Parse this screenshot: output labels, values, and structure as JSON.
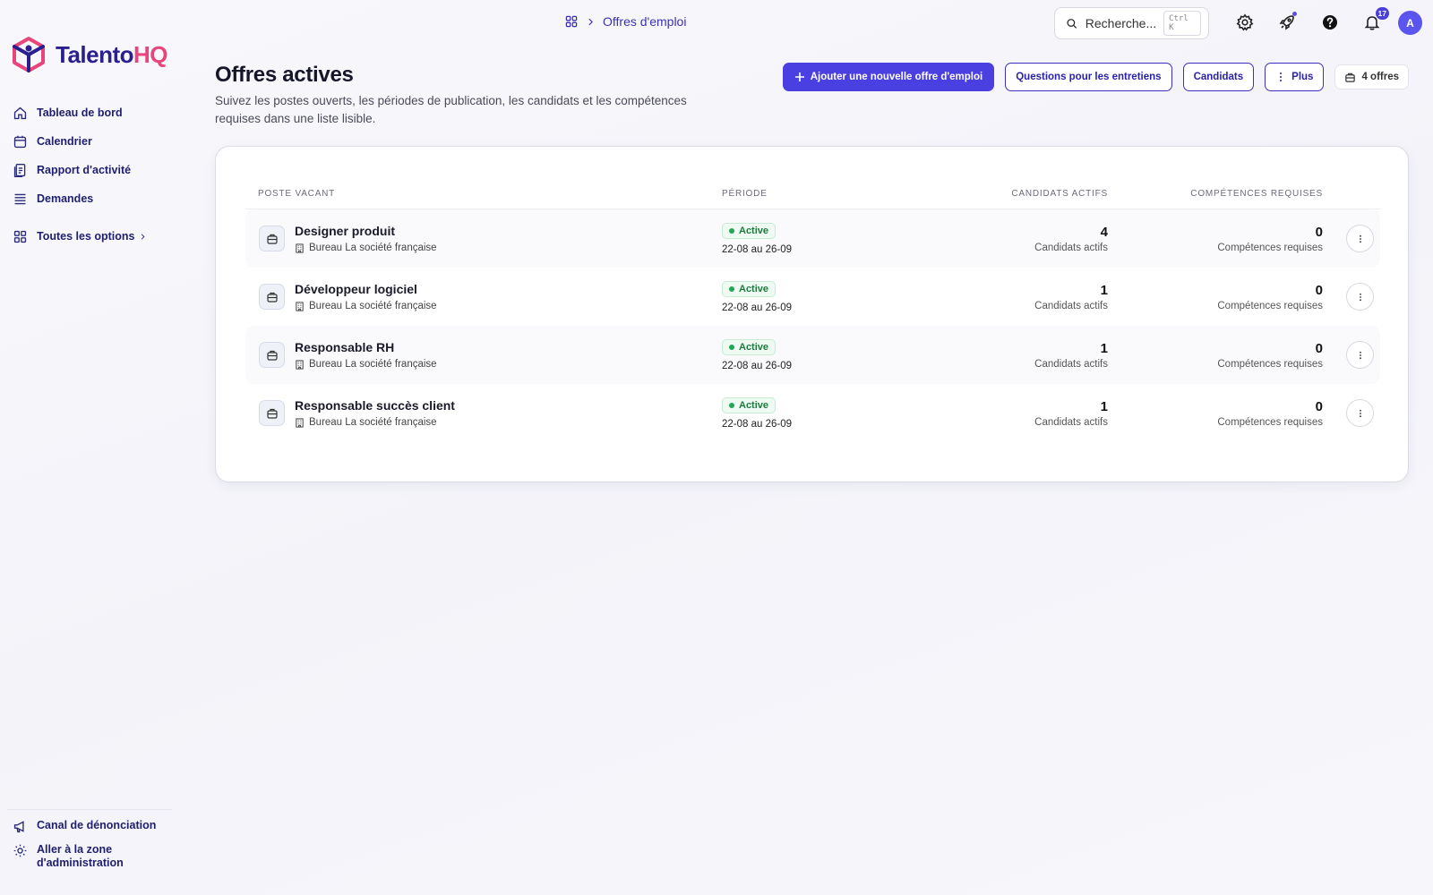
{
  "app": {
    "logo_text_main": "Talento",
    "logo_text_accent": "HQ",
    "colors": {
      "brand": "#2a1f8f",
      "accent": "#e8457a",
      "primary_button": "#4a3fe0",
      "active_status": "#22a855"
    }
  },
  "sidebar": {
    "items": [
      {
        "label": "Tableau de bord",
        "icon": "home-icon"
      },
      {
        "label": "Calendrier",
        "icon": "calendar-icon"
      },
      {
        "label": "Rapport d'activité",
        "icon": "report-icon"
      },
      {
        "label": "Demandes",
        "icon": "list-icon"
      }
    ],
    "all_options": "Toutes les options",
    "bottom": [
      {
        "label": "Canal de dénonciation",
        "icon": "megaphone-icon"
      },
      {
        "label": "Aller à la zone d'administration",
        "icon": "admin-gear-icon"
      }
    ]
  },
  "topbar": {
    "breadcrumb": "Offres d'emploi",
    "search_placeholder": "Recherche...",
    "search_shortcut": "Ctrl K",
    "notifications_count": "17",
    "avatar_initial": "A"
  },
  "header": {
    "title": "Offres actives",
    "subtitle": "Suivez les postes ouverts, les périodes de publication, les candidats et les compétences requises dans une liste lisible.",
    "buttons": {
      "add": "Ajouter une nouvelle offre d'emploi",
      "questions": "Questions pour les entretiens",
      "candidates": "Candidats",
      "more": "Plus"
    },
    "count": "4 offres"
  },
  "table": {
    "headers": {
      "position": "POSTE VACANT",
      "period": "PÉRIODE",
      "active_candidates": "CANDIDATS ACTIFS",
      "required_skills": "COMPÉTENCES REQUISES"
    },
    "rows": [
      {
        "title": "Designer produit",
        "office": "Bureau La société française",
        "status": "Active",
        "period": "22-08 au 26-09",
        "candidates": "4",
        "candidates_label": "Candidats actifs",
        "skills": "0",
        "skills_label": "Compétences requises"
      },
      {
        "title": "Développeur logiciel",
        "office": "Bureau La société française",
        "status": "Active",
        "period": "22-08 au 26-09",
        "candidates": "1",
        "candidates_label": "Candidats actifs",
        "skills": "0",
        "skills_label": "Compétences requises"
      },
      {
        "title": "Responsable RH",
        "office": "Bureau La société française",
        "status": "Active",
        "period": "22-08 au 26-09",
        "candidates": "1",
        "candidates_label": "Candidats actifs",
        "skills": "0",
        "skills_label": "Compétences requises"
      },
      {
        "title": "Responsable succès client",
        "office": "Bureau La société française",
        "status": "Active",
        "period": "22-08 au 26-09",
        "candidates": "1",
        "candidates_label": "Candidats actifs",
        "skills": "0",
        "skills_label": "Compétences requises"
      }
    ]
  }
}
